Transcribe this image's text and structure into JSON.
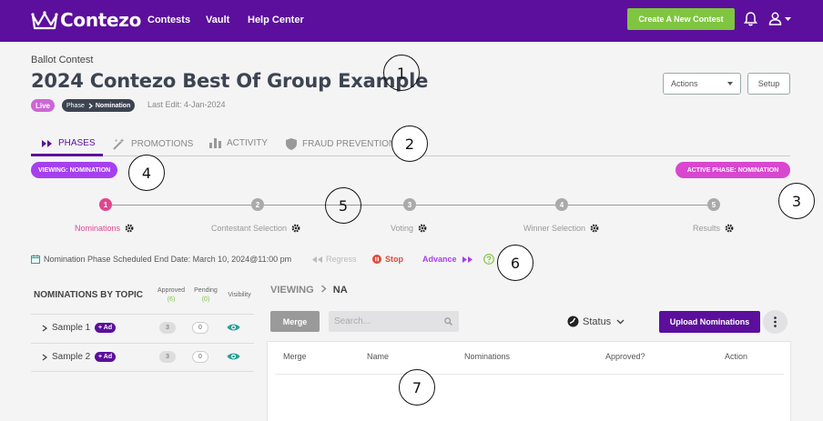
{
  "app": {
    "logo_text": "Contezo"
  },
  "nav": {
    "items": [
      "Contests",
      "Vault",
      "Help Center"
    ],
    "create_button": "Create A New Contest"
  },
  "header": {
    "type_label": "Ballot Contest",
    "title": "2024 Contezo Best Of Group Example",
    "live_badge": "Live",
    "phase_badge_prefix": "Phase",
    "phase_badge_value": "Nomination",
    "last_edit": "Last Edit: 4-Jan-2024",
    "actions_label": "Actions",
    "setup_label": "Setup"
  },
  "tabs": [
    {
      "label": "PHASES",
      "icon": "double-play-icon",
      "active": true
    },
    {
      "label": "PROMOTIONS",
      "icon": "magic-wand-icon",
      "active": false
    },
    {
      "label": "ACTIVITY",
      "icon": "bar-chart-icon",
      "active": false
    },
    {
      "label": "FRAUD PREVENTION",
      "icon": "shield-icon",
      "active": false
    }
  ],
  "viewing_pill": "VIEWING:  NOMINATION",
  "active_phase_pill": "ACTIVE PHASE:  NOMINATION",
  "steps": [
    {
      "num": "1",
      "label": "Nominations",
      "active": true
    },
    {
      "num": "2",
      "label": "Contestant Selection",
      "active": false
    },
    {
      "num": "3",
      "label": "Voting",
      "active": false
    },
    {
      "num": "4",
      "label": "Winner Selection",
      "active": false
    },
    {
      "num": "5",
      "label": "Results",
      "active": false
    }
  ],
  "schedule": {
    "text": "Nomination Phase Scheduled End Date: March 10, 2024@11:00 pm",
    "regress": "Regress",
    "stop": "Stop",
    "advance": "Advance"
  },
  "nominations_panel": {
    "title": "NOMINATIONS BY TOPIC",
    "col_approved": "Approved",
    "col_approved_count": "(6)",
    "col_pending": "Pending",
    "col_pending_count": "(0)",
    "col_visibility": "Visibility",
    "rows": [
      {
        "name": "Sample 1",
        "badge": "+ Ad",
        "approved": "3",
        "pending": "0"
      },
      {
        "name": "Sample 2",
        "badge": "+ Ad",
        "approved": "3",
        "pending": "0"
      }
    ]
  },
  "main": {
    "viewing_label": "VIEWING",
    "viewing_value": "NA",
    "merge_button": "Merge",
    "search_placeholder": "Search...",
    "status_label": "Status",
    "upload_button": "Upload Nominations",
    "columns": [
      "Merge",
      "Name",
      "Nominations",
      "Approved?",
      "Action"
    ]
  },
  "callouts": [
    "1",
    "2",
    "3",
    "4",
    "5",
    "6",
    "7"
  ],
  "colors": {
    "brand": "#5b0f9c",
    "accent_green": "#7fc540",
    "step_active": "#e0468f",
    "viewing": "#a53ff0",
    "active_phase": "#d946d0",
    "stop": "#e04a3a"
  }
}
